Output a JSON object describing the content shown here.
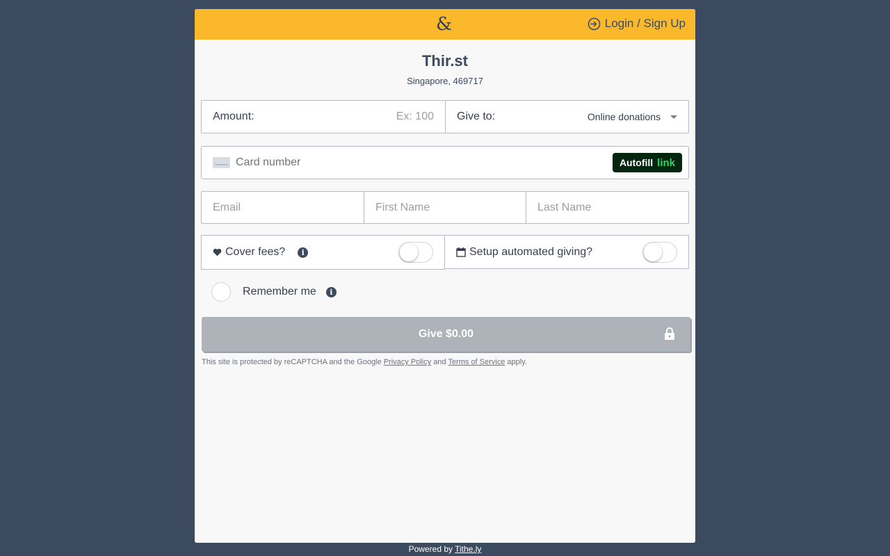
{
  "header": {
    "logo": "&",
    "login_label": "Login / Sign Up"
  },
  "organization": {
    "name": "Thir.st",
    "address": "Singapore, 469717"
  },
  "amount": {
    "label": "Amount:",
    "placeholder": "Ex: 100"
  },
  "give_to": {
    "label": "Give to:",
    "selected": "Online donations"
  },
  "card": {
    "placeholder": "Card number",
    "autofill_label": "Autofill",
    "autofill_brand": "link"
  },
  "contact": {
    "email_placeholder": "Email",
    "first_name_placeholder": "First Name",
    "last_name_placeholder": "Last Name"
  },
  "options": {
    "cover_fees_label": "Cover fees?",
    "cover_fees_on": false,
    "automated_label": "Setup automated giving?",
    "automated_on": false,
    "info_glyph": "i"
  },
  "remember": {
    "label": "Remember me"
  },
  "give_button": {
    "label": "Give $0.00"
  },
  "legal": {
    "prefix": "This site is protected by reCAPTCHA and the Google",
    "privacy": "Privacy Policy",
    "and": "and",
    "terms": "Terms of Service",
    "suffix": "apply."
  },
  "footer": {
    "prefix": "Powered by",
    "link": "Tithe.ly"
  },
  "colors": {
    "header": "#fbb82a",
    "background": "#3b4a5f",
    "button_disabled": "#aeb3b9",
    "autofill_bg": "#04260f",
    "autofill_brand": "#32d26a"
  }
}
